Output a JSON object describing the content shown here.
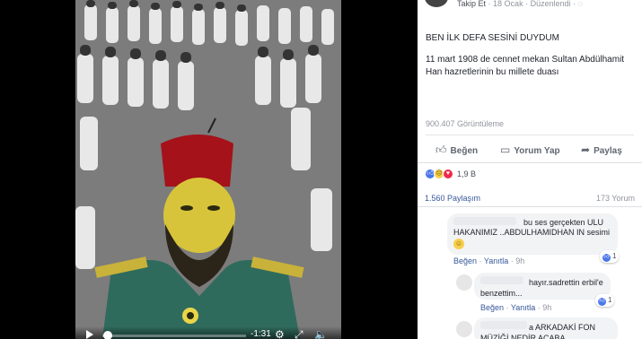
{
  "header": {
    "follow_label": "Takip Et",
    "separator": "·",
    "date": "18 Ocak",
    "edited": "Düzenlendi",
    "privacy_icon": "globe-icon"
  },
  "post": {
    "title": "BEN İLK DEFA SESİNİ DUYDUM",
    "body": "11 mart 1908 de cennet mekan Sultan Abdülhamit Han hazretlerinin bu millete duası",
    "views": "900.407 Görüntüleme"
  },
  "actions": {
    "like": "Beğen",
    "comment": "Yorum Yap",
    "share": "Paylaş"
  },
  "stats": {
    "reactions_count": "1,9 B",
    "shares": "1.560 Paylaşım",
    "comments": "173 Yorum"
  },
  "video": {
    "time": "-1:31",
    "progress": 0.02
  },
  "comments": [
    {
      "text": "bu ses gerçekten ULU HAKANIMIZ ..ABDULHAMIDHAN IN sesimi",
      "likes": "1",
      "like_action": "Beğen",
      "reply_action": "Yanıtla",
      "time": "9h"
    },
    {
      "text": "hayır.sadrettin erbil'e benzettim...",
      "likes": "1",
      "like_action": "Beğen",
      "reply_action": "Yanıtla",
      "time": "9h"
    },
    {
      "text": "a ARKADAKİ FON MÜZİĞİ NEDİR ACABA"
    }
  ],
  "colors": {
    "link_blue": "#365899",
    "muted_gray": "#90949c",
    "like_blue": "#4a76e8",
    "love_red": "#f0284a",
    "comment_bubble": "#f2f3f5"
  }
}
